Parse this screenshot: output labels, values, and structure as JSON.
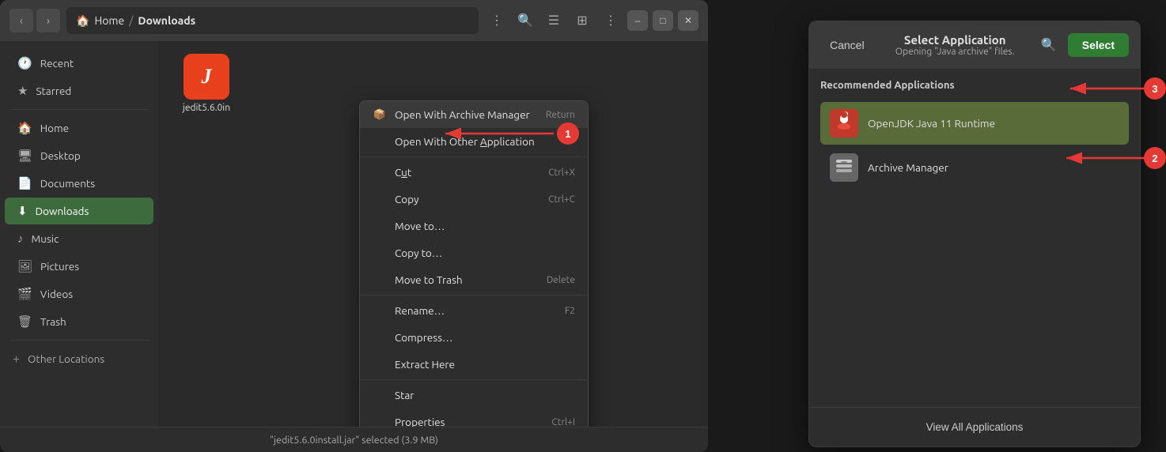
{
  "filemanager": {
    "title": "Downloads",
    "breadcrumb": {
      "home": "Home",
      "separator": "/",
      "current": "Downloads"
    },
    "sidebar": {
      "items": [
        {
          "id": "recent",
          "label": "Recent",
          "icon": "🕐"
        },
        {
          "id": "starred",
          "label": "Starred",
          "icon": "★"
        },
        {
          "id": "home",
          "label": "Home",
          "icon": "🏠"
        },
        {
          "id": "desktop",
          "label": "Desktop",
          "icon": "🖥"
        },
        {
          "id": "documents",
          "label": "Documents",
          "icon": "📄"
        },
        {
          "id": "downloads",
          "label": "Downloads",
          "icon": "⬇"
        },
        {
          "id": "music",
          "label": "Music",
          "icon": "♪"
        },
        {
          "id": "pictures",
          "label": "Pictures",
          "icon": "🖼"
        },
        {
          "id": "videos",
          "label": "Videos",
          "icon": "🎬"
        },
        {
          "id": "trash",
          "label": "Trash",
          "icon": "🗑"
        }
      ],
      "other_locations": {
        "label": "Other Locations",
        "icon": "+"
      }
    },
    "file": {
      "name": "jedit5.6.0in",
      "full_name": "jedit5.6.0install.jar"
    },
    "status_bar": "\"jedit5.6.0install.jar\" selected  (3.9 MB)",
    "context_menu": {
      "items": [
        {
          "id": "open-archive",
          "label": "Open With Archive Manager",
          "shortcut": "Return",
          "has_icon": true
        },
        {
          "id": "open-other",
          "label": "Open With Other Application",
          "shortcut": ""
        },
        {
          "id": "cut",
          "label": "Cut",
          "shortcut": "Ctrl+X"
        },
        {
          "id": "copy",
          "label": "Copy",
          "shortcut": "Ctrl+C"
        },
        {
          "id": "move-to",
          "label": "Move to…",
          "shortcut": ""
        },
        {
          "id": "copy-to",
          "label": "Copy to…",
          "shortcut": ""
        },
        {
          "id": "move-trash",
          "label": "Move to Trash",
          "shortcut": "Delete"
        },
        {
          "id": "rename",
          "label": "Rename…",
          "shortcut": "F2"
        },
        {
          "id": "compress",
          "label": "Compress…",
          "shortcut": ""
        },
        {
          "id": "extract",
          "label": "Extract Here",
          "shortcut": ""
        },
        {
          "id": "star",
          "label": "Star",
          "shortcut": ""
        },
        {
          "id": "properties",
          "label": "Properties",
          "shortcut": "Ctrl+I"
        }
      ]
    }
  },
  "dialog": {
    "title": "Select Application",
    "subtitle": "Opening \"Java archive\" files.",
    "cancel_label": "Cancel",
    "select_label": "Select",
    "view_all_label": "View All Applications",
    "section_label": "Recommended Applications",
    "apps": [
      {
        "id": "openjdk",
        "label": "OpenJDK Java 11 Runtime",
        "icon_type": "java"
      },
      {
        "id": "archive",
        "label": "Archive Manager",
        "icon_type": "archive"
      }
    ]
  },
  "annotations": {
    "arrow1_label": "1",
    "arrow2_label": "2",
    "arrow3_label": "3"
  }
}
